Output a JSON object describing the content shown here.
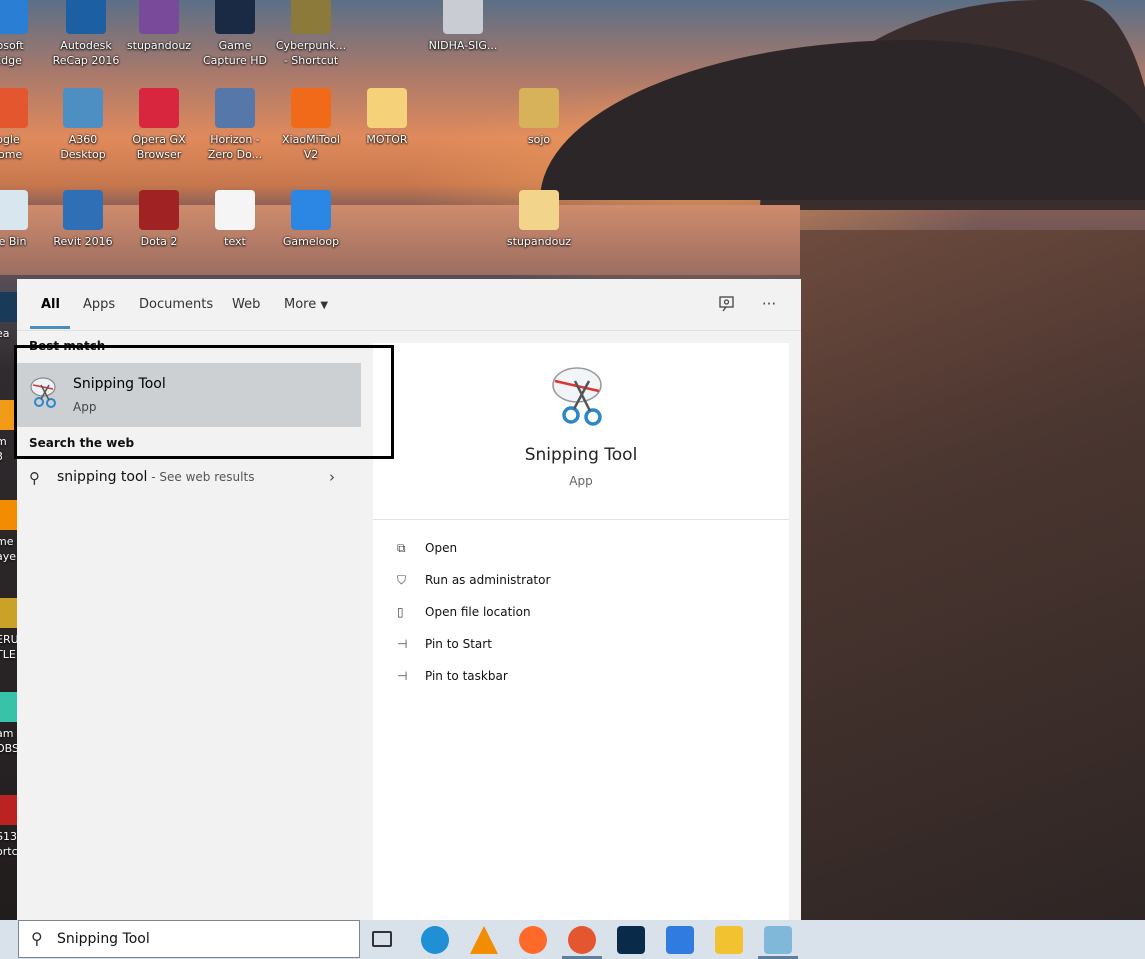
{
  "desktop": {
    "icons": [
      {
        "label": "rosoft\nEdge",
        "color": "#2a7fd4"
      },
      {
        "label": "Autodesk\nReCap 2016",
        "color": "#1c5fa3"
      },
      {
        "label": "stupandouz",
        "color": "#7a4a9a"
      },
      {
        "label": "Game\nCapture HD",
        "color": "#1b2a44"
      },
      {
        "label": "Cyberpunk...\n- Shortcut",
        "color": "#8c7a3a"
      },
      {
        "label": "NIDHA-SIG...",
        "color": "#c9ccd3"
      },
      {
        "label": "ogle\nrome",
        "color": "#e4572e"
      },
      {
        "label": "A360 Desktop",
        "color": "#4d8fc2"
      },
      {
        "label": "Opera GX\nBrowser",
        "color": "#d7263d"
      },
      {
        "label": "Horizon -\nZero Do...",
        "color": "#5577aa"
      },
      {
        "label": "XiaoMiTool\nV2",
        "color": "#f06a1a"
      },
      {
        "label": "MOTOR",
        "color": "#f5d27a"
      },
      {
        "label": "sojo",
        "color": "#d8b25a"
      },
      {
        "label": "cle Bin",
        "color": "#d8e6f0"
      },
      {
        "label": "Revit 2016",
        "color": "#2f6fb5"
      },
      {
        "label": "Dota 2",
        "color": "#a02222"
      },
      {
        "label": "text",
        "color": "#f5f5f5"
      },
      {
        "label": "Gameloop",
        "color": "#2b87e3"
      },
      {
        "label": "stupandouz",
        "color": "#f2d48a"
      }
    ],
    "left_strip": [
      "ea",
      "m\n3",
      "me\naye",
      "ERU\nTLE",
      "am\nOBS",
      "S13\nortc"
    ]
  },
  "search_panel": {
    "tabs": {
      "all": "All",
      "apps": "Apps",
      "documents": "Documents",
      "web": "Web",
      "more": "More"
    },
    "best_match_header": "Best match",
    "best_match": {
      "title": "Snipping Tool",
      "subtitle": "App"
    },
    "search_web_header": "Search the web",
    "web_result": {
      "query": "snipping tool",
      "suffix": " - See web results"
    },
    "detail": {
      "title": "Snipping Tool",
      "subtitle": "App",
      "actions": [
        "Open",
        "Run as administrator",
        "Open file location",
        "Pin to Start",
        "Pin to taskbar"
      ]
    }
  },
  "taskbar": {
    "search_text": "Snipping Tool",
    "apps": [
      {
        "name": "task-view",
        "color": "#333333"
      },
      {
        "name": "edge",
        "color": "#1f8fd6"
      },
      {
        "name": "vlc",
        "color": "#f28c00"
      },
      {
        "name": "firefox",
        "color": "#ff6a2b"
      },
      {
        "name": "chrome",
        "color": "#e4572e"
      },
      {
        "name": "photoshop",
        "color": "#0a2a4a"
      },
      {
        "name": "wps",
        "color": "#2f7be0"
      },
      {
        "name": "file-explorer",
        "color": "#f2c230"
      },
      {
        "name": "snipping-tool",
        "color": "#7fb8d8"
      }
    ]
  }
}
